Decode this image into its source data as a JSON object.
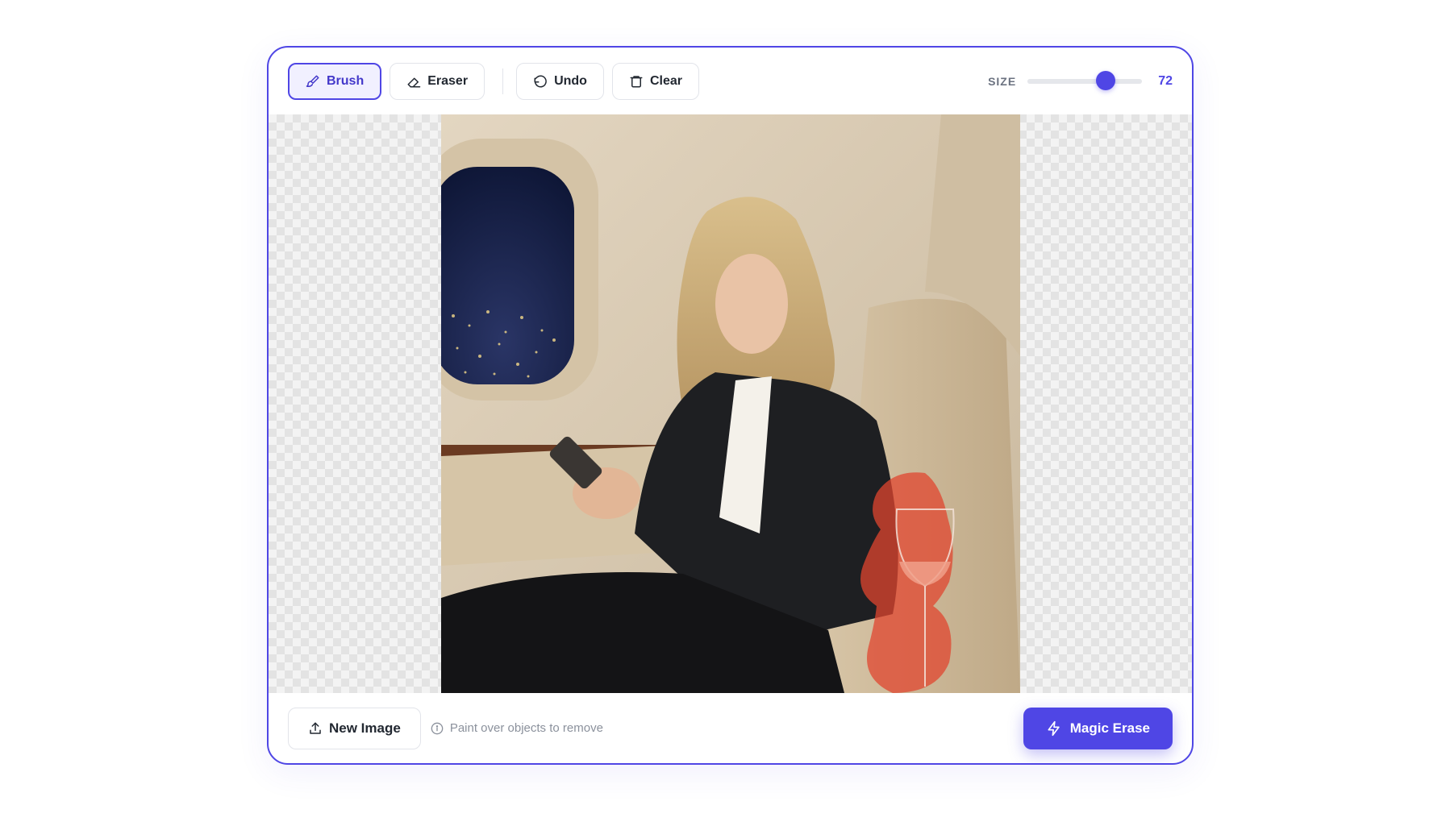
{
  "toolbar": {
    "brush_label": "Brush",
    "eraser_label": "Eraser",
    "undo_label": "Undo",
    "clear_label": "Clear",
    "size_label": "SIZE",
    "size_value": "72",
    "size_slider_fraction": 0.68
  },
  "canvas": {
    "active_tool": "Brush"
  },
  "footer": {
    "new_image_label": "New Image",
    "hint_text": "Paint over objects to remove",
    "magic_erase_label": "Magic Erase"
  },
  "colors": {
    "accent": "#4f46e5",
    "mask": "#e0462f"
  },
  "icons": [
    "brush-icon",
    "eraser-icon",
    "undo-icon",
    "trash-icon",
    "upload-icon",
    "info-icon",
    "lightning-icon"
  ]
}
